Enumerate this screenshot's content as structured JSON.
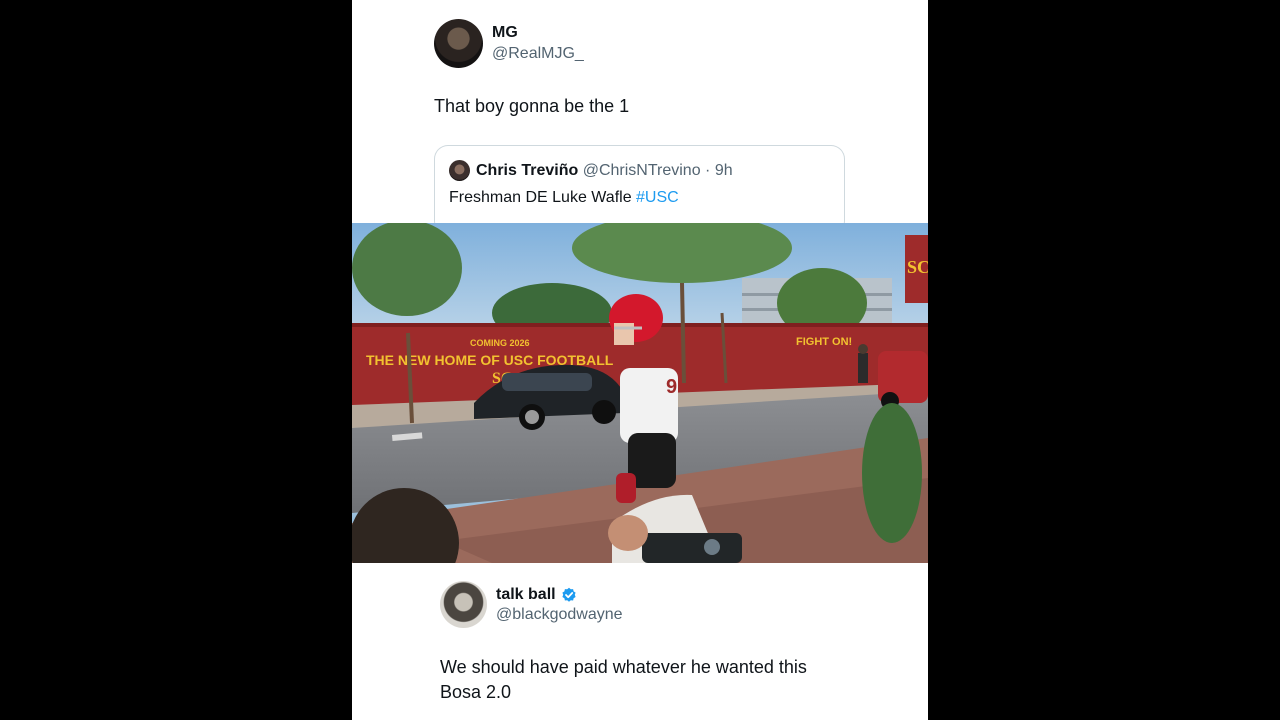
{
  "tweet1": {
    "name": "MG",
    "handle": "@RealMJG_",
    "text": "That boy gonna be the 1",
    "quote": {
      "name": "Chris Treviño",
      "handle_time": "@ChrisNTrevino · 9h",
      "text": "Freshman DE Luke Wafle ",
      "hashtag": "#USC"
    }
  },
  "video": {
    "banner_small": "COMING 2026",
    "banner_main": "THE NEW HOME OF USC FOOTBALL",
    "banner_right": "FIGHT ON!",
    "jersey_number": "9"
  },
  "tweet2": {
    "name": "talk ball",
    "handle": "@blackgodwayne",
    "text_line1": "We should have paid whatever he wanted this",
    "text_line2": "Bosa 2.0"
  },
  "colors": {
    "verified": "#1d9bf0",
    "hashtag": "#1d9bf0",
    "usc_cardinal": "#9e2b2b",
    "usc_gold": "#f2c230"
  }
}
